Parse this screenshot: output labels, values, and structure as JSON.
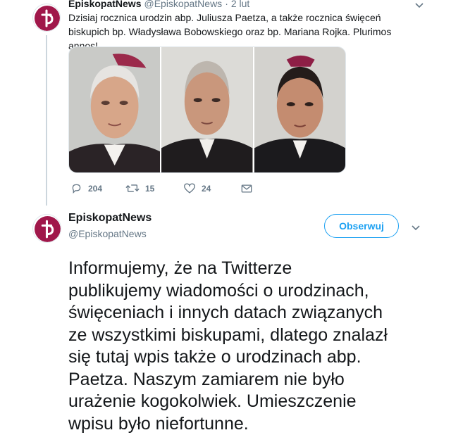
{
  "tweet1": {
    "display_name": "EpiskopatNews",
    "handle": "@EpiskopatNews",
    "separator": "·",
    "time": "2 lut",
    "text": "Dzisiaj rocznica urodzin abp. Juliusza Paetza, a także rocznica święceń biskupich bp. Władysława Bobowskiego oraz bp. Mariana Rojka. Plurimos annos!",
    "photos": [
      "bishop-photo-1",
      "bishop-photo-2",
      "bishop-photo-3"
    ],
    "actions": {
      "reply_count": "204",
      "retweet_count": "15",
      "like_count": "24"
    }
  },
  "tweet2": {
    "display_name": "EpiskopatNews",
    "handle": "@EpiskopatNews",
    "follow_label": "Obserwuj",
    "text_lines": [
      "Informujemy, że na Twitterze",
      "publikujemy wiadomości o urodzinach,",
      "święceniach i innych datach związanych",
      "ze wszystkimi biskupami, dlatego znalazł",
      "się tutaj wpis także o urodzinach abp.",
      "Paetza. Naszym zamiarem nie było",
      "urażenie kogokolwiek. Umieszczenie",
      "wpisu było niefortunne."
    ]
  },
  "colors": {
    "brand": "#a0174a",
    "accent": "#1da1f2",
    "muted": "#657786",
    "border": "#e1e8ed"
  },
  "icons": [
    "episkopat-logo",
    "chevron-down-icon",
    "reply-icon",
    "retweet-icon",
    "like-icon",
    "message-icon"
  ]
}
